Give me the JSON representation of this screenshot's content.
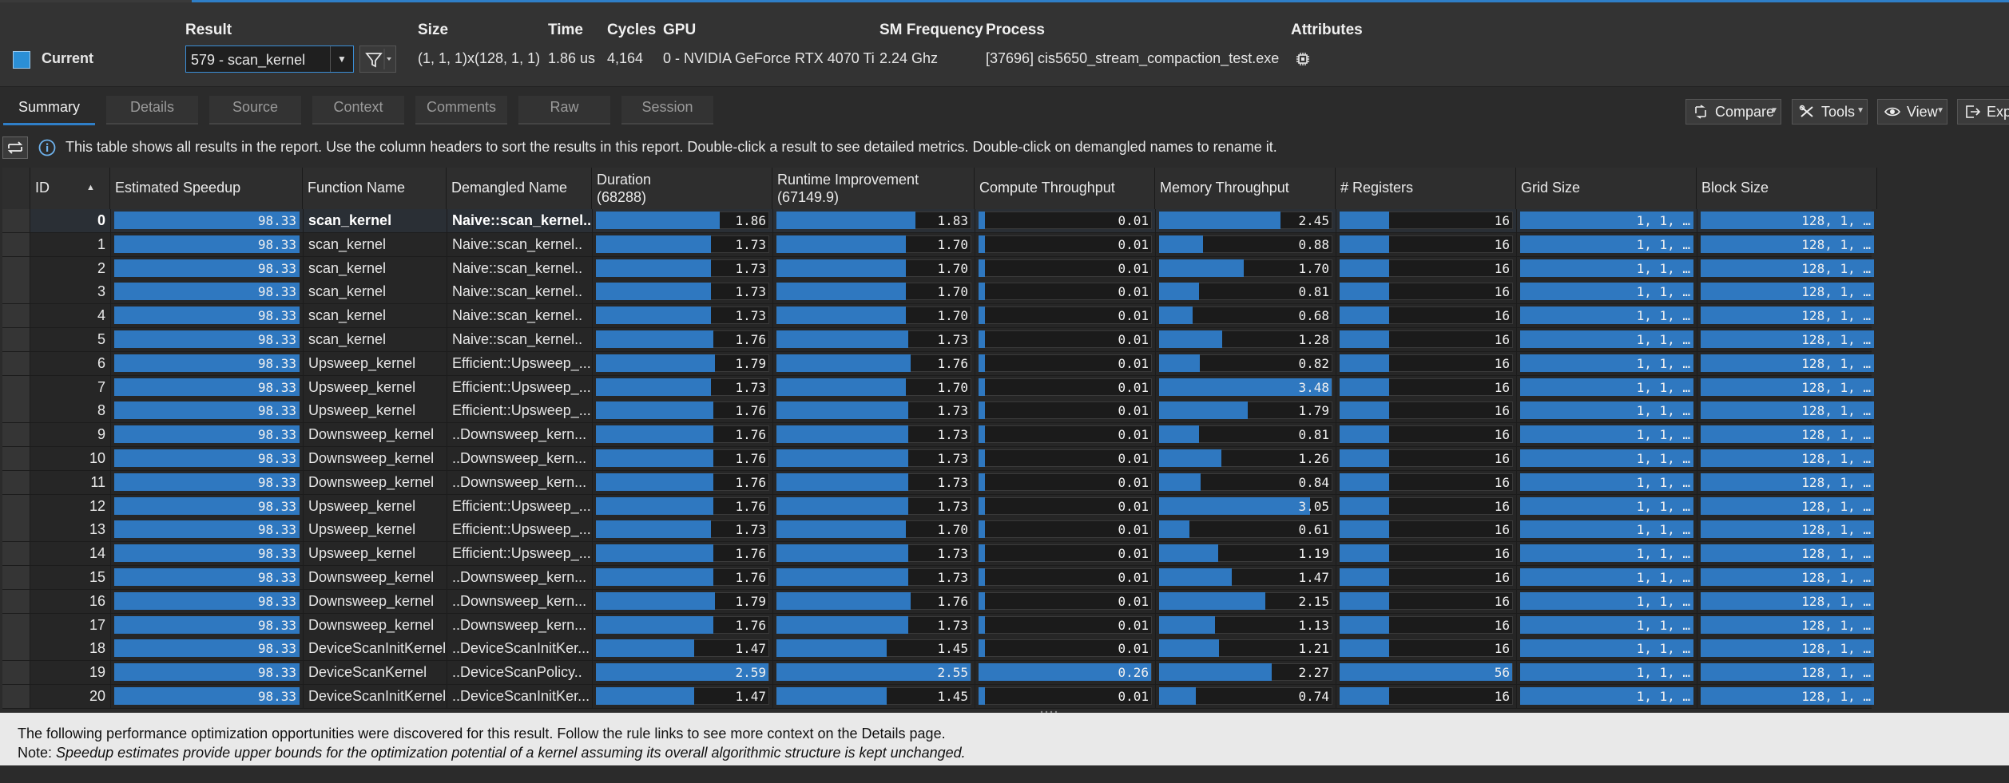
{
  "header": {
    "current_label": "Current",
    "result": {
      "label": "Result",
      "value": "579 - scan_kernel"
    },
    "size": {
      "label": "Size",
      "value": "(1, 1, 1)x(128, 1, 1)"
    },
    "time": {
      "label": "Time",
      "value": "1.86 us"
    },
    "cycles": {
      "label": "Cycles",
      "value": "4,164"
    },
    "gpu": {
      "label": "GPU",
      "value": "0 - NVIDIA GeForce RTX 4070 Ti"
    },
    "sm_frequency": {
      "label": "SM Frequency",
      "value": "2.24 Ghz"
    },
    "process": {
      "label": "Process",
      "value": "[37696] cis5650_stream_compaction_test.exe"
    },
    "attributes": {
      "label": "Attributes"
    },
    "accent_color": "#2f7fc8"
  },
  "tabs": [
    "Summary",
    "Details",
    "Source",
    "Context",
    "Comments",
    "Raw",
    "Session"
  ],
  "toolbar": {
    "compare": "Compare",
    "tools": "Tools",
    "view": "View",
    "export": "Expo"
  },
  "info_text": "This table shows all results in the report. Use the column headers to sort the results in this report. Double-click a result to see detailed metrics. Double-click on demangled names to rename it.",
  "table": {
    "columns": {
      "id": "ID",
      "speedup": "Estimated Speedup",
      "function": "Function Name",
      "demangled": "Demangled Name",
      "duration": "Duration",
      "duration_total": "(68288)",
      "runtime": "Runtime Improvement",
      "runtime_total": "(67149.9)",
      "compute": "Compute Throughput",
      "memory": "Memory Throughput",
      "registers": "# Registers",
      "grid": "Grid Size",
      "block": "Block Size"
    },
    "grid_text": "1,     1,     …",
    "block_text": "128,     1,     …",
    "rows": [
      {
        "id": "0",
        "speedup": "98.33",
        "function": "scan_kernel",
        "demangled": "Naive::scan_kernel..",
        "duration": "1.86",
        "runtime": "1.83",
        "compute": "0.01",
        "memory": "2.45",
        "registers": "16"
      },
      {
        "id": "1",
        "speedup": "98.33",
        "function": "scan_kernel",
        "demangled": "Naive::scan_kernel..",
        "duration": "1.73",
        "runtime": "1.70",
        "compute": "0.01",
        "memory": "0.88",
        "registers": "16"
      },
      {
        "id": "2",
        "speedup": "98.33",
        "function": "scan_kernel",
        "demangled": "Naive::scan_kernel..",
        "duration": "1.73",
        "runtime": "1.70",
        "compute": "0.01",
        "memory": "1.70",
        "registers": "16"
      },
      {
        "id": "3",
        "speedup": "98.33",
        "function": "scan_kernel",
        "demangled": "Naive::scan_kernel..",
        "duration": "1.73",
        "runtime": "1.70",
        "compute": "0.01",
        "memory": "0.81",
        "registers": "16"
      },
      {
        "id": "4",
        "speedup": "98.33",
        "function": "scan_kernel",
        "demangled": "Naive::scan_kernel..",
        "duration": "1.73",
        "runtime": "1.70",
        "compute": "0.01",
        "memory": "0.68",
        "registers": "16"
      },
      {
        "id": "5",
        "speedup": "98.33",
        "function": "scan_kernel",
        "demangled": "Naive::scan_kernel..",
        "duration": "1.76",
        "runtime": "1.73",
        "compute": "0.01",
        "memory": "1.28",
        "registers": "16"
      },
      {
        "id": "6",
        "speedup": "98.33",
        "function": "Upsweep_kernel",
        "demangled": "Efficient::Upsweep_...",
        "duration": "1.79",
        "runtime": "1.76",
        "compute": "0.01",
        "memory": "0.82",
        "registers": "16"
      },
      {
        "id": "7",
        "speedup": "98.33",
        "function": "Upsweep_kernel",
        "demangled": "Efficient::Upsweep_...",
        "duration": "1.73",
        "runtime": "1.70",
        "compute": "0.01",
        "memory": "3.48",
        "registers": "16"
      },
      {
        "id": "8",
        "speedup": "98.33",
        "function": "Upsweep_kernel",
        "demangled": "Efficient::Upsweep_...",
        "duration": "1.76",
        "runtime": "1.73",
        "compute": "0.01",
        "memory": "1.79",
        "registers": "16"
      },
      {
        "id": "9",
        "speedup": "98.33",
        "function": "Downsweep_kernel",
        "demangled": "..Downsweep_kern...",
        "duration": "1.76",
        "runtime": "1.73",
        "compute": "0.01",
        "memory": "0.81",
        "registers": "16"
      },
      {
        "id": "10",
        "speedup": "98.33",
        "function": "Downsweep_kernel",
        "demangled": "..Downsweep_kern...",
        "duration": "1.76",
        "runtime": "1.73",
        "compute": "0.01",
        "memory": "1.26",
        "registers": "16"
      },
      {
        "id": "11",
        "speedup": "98.33",
        "function": "Downsweep_kernel",
        "demangled": "..Downsweep_kern...",
        "duration": "1.76",
        "runtime": "1.73",
        "compute": "0.01",
        "memory": "0.84",
        "registers": "16"
      },
      {
        "id": "12",
        "speedup": "98.33",
        "function": "Upsweep_kernel",
        "demangled": "Efficient::Upsweep_...",
        "duration": "1.76",
        "runtime": "1.73",
        "compute": "0.01",
        "memory": "3.05",
        "registers": "16"
      },
      {
        "id": "13",
        "speedup": "98.33",
        "function": "Upsweep_kernel",
        "demangled": "Efficient::Upsweep_...",
        "duration": "1.73",
        "runtime": "1.70",
        "compute": "0.01",
        "memory": "0.61",
        "registers": "16"
      },
      {
        "id": "14",
        "speedup": "98.33",
        "function": "Upsweep_kernel",
        "demangled": "Efficient::Upsweep_...",
        "duration": "1.76",
        "runtime": "1.73",
        "compute": "0.01",
        "memory": "1.19",
        "registers": "16"
      },
      {
        "id": "15",
        "speedup": "98.33",
        "function": "Downsweep_kernel",
        "demangled": "..Downsweep_kern...",
        "duration": "1.76",
        "runtime": "1.73",
        "compute": "0.01",
        "memory": "1.47",
        "registers": "16"
      },
      {
        "id": "16",
        "speedup": "98.33",
        "function": "Downsweep_kernel",
        "demangled": "..Downsweep_kern...",
        "duration": "1.79",
        "runtime": "1.76",
        "compute": "0.01",
        "memory": "2.15",
        "registers": "16"
      },
      {
        "id": "17",
        "speedup": "98.33",
        "function": "Downsweep_kernel",
        "demangled": "..Downsweep_kern...",
        "duration": "1.76",
        "runtime": "1.73",
        "compute": "0.01",
        "memory": "1.13",
        "registers": "16"
      },
      {
        "id": "18",
        "speedup": "98.33",
        "function": "DeviceScanInitKernel",
        "demangled": "..DeviceScanInitKer...",
        "duration": "1.47",
        "runtime": "1.45",
        "compute": "0.01",
        "memory": "1.21",
        "registers": "16"
      },
      {
        "id": "19",
        "speedup": "98.33",
        "function": "DeviceScanKernel",
        "demangled": "..DeviceScanPolicy..",
        "duration": "2.59",
        "runtime": "2.55",
        "compute": "0.26",
        "memory": "2.27",
        "registers": "56"
      },
      {
        "id": "20",
        "speedup": "98.33",
        "function": "DeviceScanInitKernel",
        "demangled": "..DeviceScanInitKer...",
        "duration": "1.47",
        "runtime": "1.45",
        "compute": "0.01",
        "memory": "0.74",
        "registers": "16"
      }
    ]
  },
  "footer": {
    "line1": "The following performance optimization opportunities were discovered for this result. Follow the rule links to see more context on the Details page.",
    "note_label": "Note: ",
    "note_text": "Speedup estimates provide upper bounds for the optimization potential of a kernel assuming its overall algorithmic structure is kept unchanged."
  }
}
